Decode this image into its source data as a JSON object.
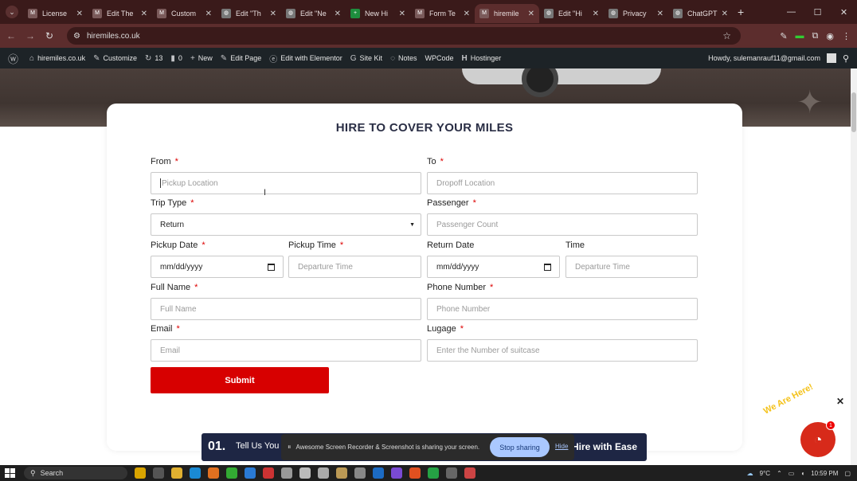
{
  "browser": {
    "tabs": [
      {
        "label": "License",
        "color": "#7a5a5a",
        "glyph": "M"
      },
      {
        "label": "Edit The",
        "color": "#7a5a5a",
        "glyph": "M"
      },
      {
        "label": "Custom",
        "color": "#7a5a5a",
        "glyph": "M"
      },
      {
        "label": "Edit \"Th",
        "color": "#777777",
        "glyph": "◍"
      },
      {
        "label": "Edit \"Ne",
        "color": "#777777",
        "glyph": "◍"
      },
      {
        "label": "New Hi",
        "color": "#1e8e3e",
        "glyph": "+"
      },
      {
        "label": "Form Te",
        "color": "#7a5a5a",
        "glyph": "M"
      },
      {
        "label": "hiremile",
        "color": "#7a5a5a",
        "glyph": "M"
      },
      {
        "label": "Edit \"Hi",
        "color": "#777777",
        "glyph": "◍"
      },
      {
        "label": "Privacy",
        "color": "#777777",
        "glyph": "◍"
      },
      {
        "label": "ChatGPT",
        "color": "#777777",
        "glyph": "◍"
      }
    ],
    "active_tab": 7,
    "url": "hiremiles.co.uk"
  },
  "wp_admin_bar": {
    "site": "hiremiles.co.uk",
    "customize": "Customize",
    "updates": "13",
    "comments": "0",
    "new": "New",
    "edit_page": "Edit Page",
    "elementor": "Edit with Elementor",
    "site_kit": "Site Kit",
    "notes": "Notes",
    "wpcode": "WPCode",
    "hostinger": "Hostinger",
    "howdy": "Howdy, sulemanrauf11@gmail.com"
  },
  "form": {
    "title": "HIRE TO COVER YOUR MILES",
    "from_label": "From",
    "from_placeholder": "Pickup Location",
    "to_label": "To",
    "to_placeholder": "Dropoff Location",
    "trip_type_label": "Trip Type",
    "trip_type_value": "Return",
    "passenger_label": "Passenger",
    "passenger_placeholder": "Passenger Count",
    "pickup_date_label": "Pickup Date",
    "pickup_date_placeholder": "mm/dd/yyyy",
    "pickup_time_label": "Pickup Time",
    "pickup_time_placeholder": "Departure Time",
    "return_date_label": "Return Date",
    "return_date_placeholder": "mm/dd/yyyy",
    "time_label": "Time",
    "time_placeholder": "Departure Time",
    "full_name_label": "Full Name",
    "full_name_placeholder": "Full Name",
    "phone_label": "Phone Number",
    "phone_placeholder": "Phone Number",
    "email_label": "Email",
    "email_placeholder": "Email",
    "luggage_label": "Lugage",
    "luggage_placeholder": "Enter the Number of suitcase",
    "required_mark": "*",
    "submit_label": "Submit"
  },
  "banner": {
    "number": "01.",
    "left_text": "Tell Us You",
    "right_text": "Hire with Ease"
  },
  "sharing": {
    "message": "Awesome Screen Recorder & Screenshot is sharing your screen.",
    "stop_label": "Stop sharing",
    "hide_label": "Hide"
  },
  "chat_widget": {
    "tagline": "We Are Here!",
    "badge": "1"
  },
  "taskbar": {
    "search_label": "Search",
    "temperature": "9°C",
    "time": "10:59 PM"
  }
}
